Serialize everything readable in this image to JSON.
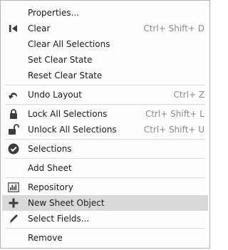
{
  "menu": {
    "items": [
      {
        "label": "Properties...",
        "shortcut": "",
        "icon": ""
      },
      {
        "label": "Clear",
        "shortcut": "Ctrl+ Shift+ D",
        "icon": "clear-icon"
      },
      {
        "label": "Clear All Selections",
        "shortcut": "",
        "icon": ""
      },
      {
        "label": "Set Clear State",
        "shortcut": "",
        "icon": ""
      },
      {
        "label": "Reset Clear State",
        "shortcut": "",
        "icon": ""
      },
      {
        "label": "Undo Layout",
        "shortcut": "Ctrl+ Z",
        "icon": "undo-icon"
      },
      {
        "label": "Lock All Selections",
        "shortcut": "Ctrl+ Shift+ L",
        "icon": "lock-icon"
      },
      {
        "label": "Unlock All Selections",
        "shortcut": "Ctrl+ Shift+ U",
        "icon": "unlock-icon"
      },
      {
        "label": "Selections",
        "shortcut": "",
        "icon": "selections-check-icon"
      },
      {
        "label": "Add Sheet",
        "shortcut": "",
        "icon": ""
      },
      {
        "label": "Repository",
        "shortcut": "",
        "icon": "repository-icon"
      },
      {
        "label": "New Sheet Object",
        "shortcut": "",
        "icon": "plus-icon"
      },
      {
        "label": "Select Fields...",
        "shortcut": "",
        "icon": "select-fields-icon"
      },
      {
        "label": "Remove",
        "shortcut": "",
        "icon": ""
      }
    ],
    "highlighted_index": 11
  },
  "colors": {
    "highlight": "#d9d9d9",
    "icon": "#3c3c3c",
    "shortcut": "#8a8a8a"
  }
}
